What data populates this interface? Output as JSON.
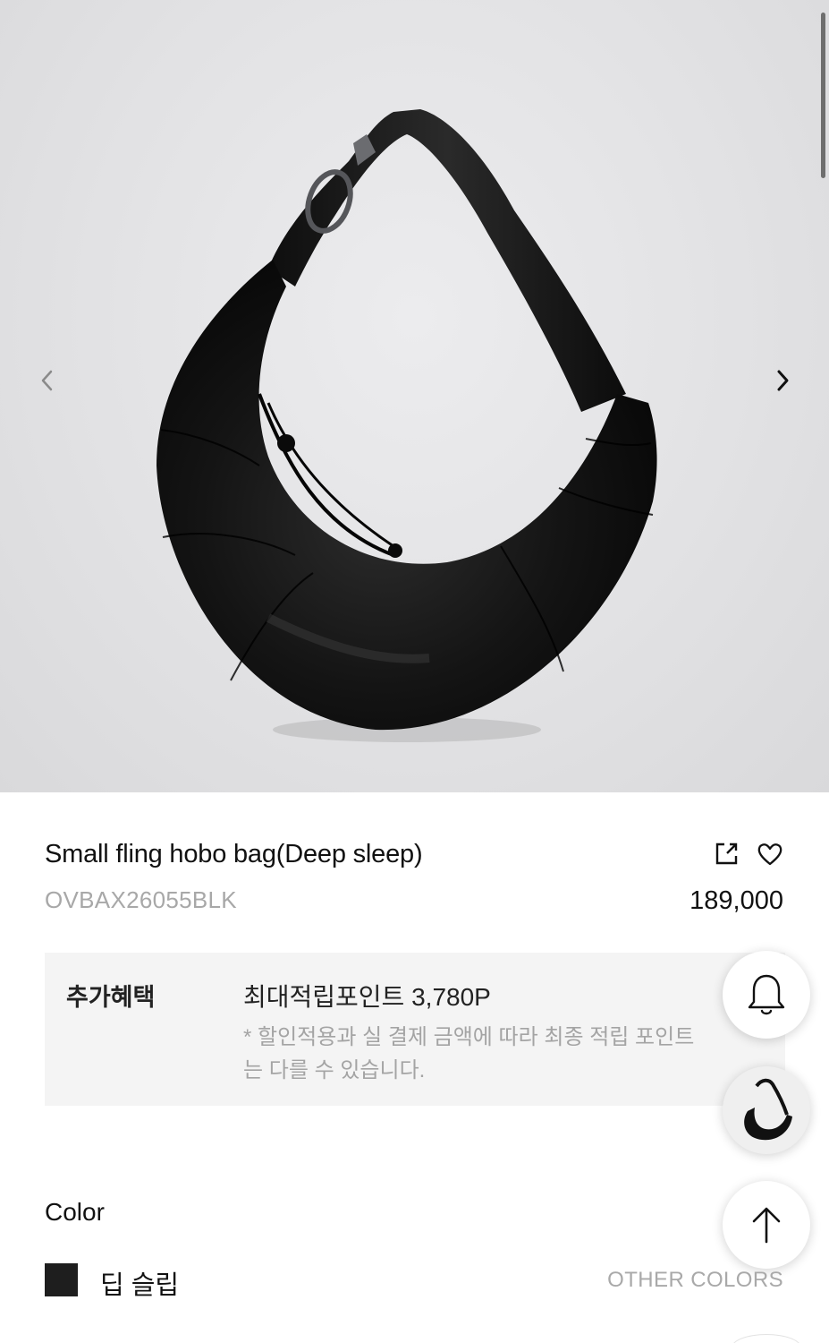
{
  "gallery": {
    "image_alt": "black leather crescent hobo bag",
    "prev_icon": "chevron-left-icon",
    "next_icon": "chevron-right-icon"
  },
  "product": {
    "name": "Small fling hobo bag(Deep sleep)",
    "sku": "OVBAX26055BLK",
    "price": "189,000",
    "share_icon": "share-icon",
    "wishlist_icon": "heart-icon"
  },
  "benefit": {
    "label": "추가혜택",
    "points": "최대적립포인트 3,780P",
    "note": "* 할인적용과 실 결제 금액에 따라 최종 적립 포인트는 다를 수 있습니다."
  },
  "color": {
    "heading": "Color",
    "selected_name": "딥 슬립",
    "selected_hex": "#1e1e1e",
    "other_colors_label": "OTHER COLORS"
  },
  "floating": {
    "bell_icon": "bell-icon",
    "thumbnail_icon": "recent-product-thumbnail",
    "top_icon": "arrow-up-icon"
  }
}
